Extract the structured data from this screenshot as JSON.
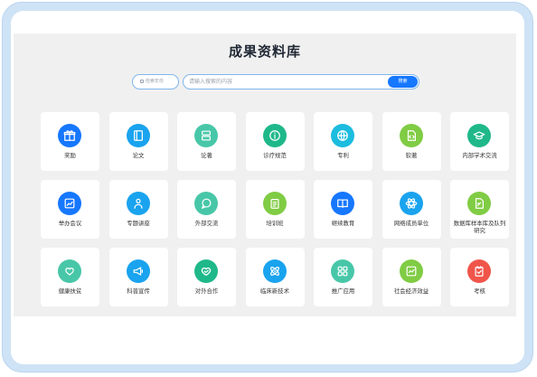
{
  "header": {
    "title": "成果资料库"
  },
  "search": {
    "year_placeholder": "检索年份",
    "input_placeholder": "请输入搜索的内容",
    "button_label": "搜索"
  },
  "cards": [
    {
      "label": "奖励",
      "icon": "gift-icon",
      "color": "#1677ff"
    },
    {
      "label": "论文",
      "icon": "book-icon",
      "color": "#1aa3ee"
    },
    {
      "label": "论著",
      "icon": "layers-icon",
      "color": "#48c7a8"
    },
    {
      "label": "诊疗规范",
      "icon": "info-icon",
      "color": "#1fb88a"
    },
    {
      "label": "专利",
      "icon": "globe-icon",
      "color": "#1cbcdf"
    },
    {
      "label": "软著",
      "icon": "code-file-icon",
      "color": "#80cc44"
    },
    {
      "label": "内部学术交流",
      "icon": "graduation-cap-icon",
      "color": "#1fb88a"
    },
    {
      "label": "举办会议",
      "icon": "chart-card-icon",
      "color": "#1677ff"
    },
    {
      "label": "专题讲座",
      "icon": "presenter-icon",
      "color": "#1aa3ee"
    },
    {
      "label": "外部交流",
      "icon": "chat-icon",
      "color": "#48c7a8"
    },
    {
      "label": "培训班",
      "icon": "clipboard-icon",
      "color": "#80cc44"
    },
    {
      "label": "继续教育",
      "icon": "open-book-icon",
      "color": "#1677ff"
    },
    {
      "label": "网络成员单位",
      "icon": "network-icon",
      "color": "#1aa3ee"
    },
    {
      "label": "数据库样本库及队列研究",
      "icon": "edit-doc-icon",
      "color": "#80cc44"
    },
    {
      "label": "健康扶贫",
      "icon": "heart-hand-icon",
      "color": "#48c7a8"
    },
    {
      "label": "科普宣传",
      "icon": "megaphone-icon",
      "color": "#1aa3ee"
    },
    {
      "label": "对外合作",
      "icon": "handshake-heart-icon",
      "color": "#1fb88a"
    },
    {
      "label": "临床新技术",
      "icon": "atom-icon",
      "color": "#1aa3ee"
    },
    {
      "label": "推广应用",
      "icon": "apps-icon",
      "color": "#48c7a8"
    },
    {
      "label": "社会经济效益",
      "icon": "trend-icon",
      "color": "#80cc44"
    },
    {
      "label": "考核",
      "icon": "check-clipboard-icon",
      "color": "#f0554a"
    }
  ]
}
